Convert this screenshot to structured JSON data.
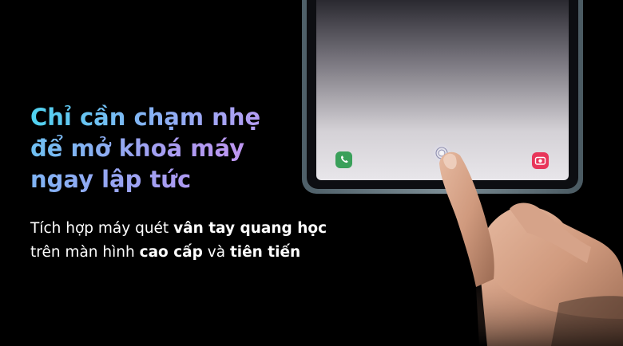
{
  "headline": {
    "line1": "Chỉ cần chạm nhẹ",
    "line2": "để mở khoá máy",
    "line3": "ngay lập tức"
  },
  "body": {
    "line1_a": "Tích hợp máy quét ",
    "line1_b": "vân tay quang học",
    "line2_a": "trên màn hình ",
    "line2_b": "cao cấp",
    "line2_c": " và ",
    "line2_d": "tiên tiến"
  },
  "icons": {
    "left": "phone-icon",
    "center": "fingerprint-icon",
    "right": "camera-icon"
  },
  "colors": {
    "background": "#000000",
    "phone_icon_bg": "#3aa05a",
    "camera_icon_bg": "#e8365a",
    "tablet_frame": "#5d6f78",
    "headline_start": "#4fd3f0",
    "headline_end": "#c394f0"
  }
}
